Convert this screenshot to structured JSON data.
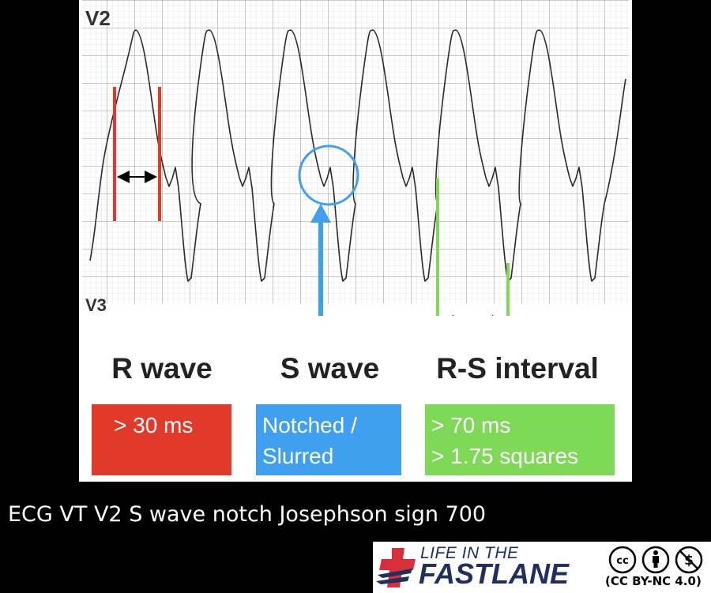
{
  "figure": {
    "lead_label": "V2",
    "colors": {
      "r_wave": "#e03a2a",
      "s_wave": "#3fa0f0",
      "rs_interval": "#7ed957",
      "trace": "#2a2a2a",
      "grid": "#b0b0b0"
    }
  },
  "labels": {
    "r_wave": "R wave",
    "s_wave": "S wave",
    "rs_interval": "R-S interval"
  },
  "criteria": {
    "r_wave": [
      "> 30 ms"
    ],
    "s_wave": [
      "Notched /",
      "Slurred"
    ],
    "rs_interval": [
      "> 70 ms",
      "> 1.75 squares"
    ]
  },
  "caption": "ECG VT V2 S wave notch Josephson sign 700",
  "logo": {
    "line1": "LIFE IN THE",
    "line2": "FASTLANE",
    "license_icons": [
      "cc-icon",
      "by-icon",
      "nc-icon"
    ],
    "license": "(CC BY-NC 4.0)"
  }
}
